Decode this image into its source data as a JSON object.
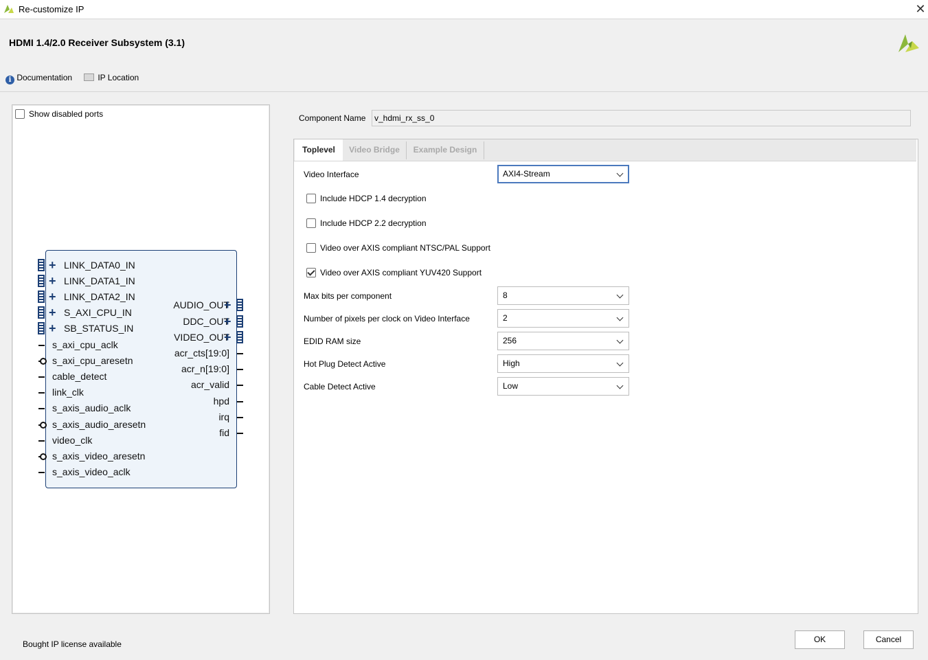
{
  "window": {
    "title": "Re-customize IP",
    "close_glyph": "✕"
  },
  "header": {
    "title": "HDMI 1.4/2.0 Receiver Subsystem (3.1)"
  },
  "toolbar": {
    "documentation": "Documentation",
    "ip_location": "IP Location"
  },
  "symbol": {
    "show_disabled_ports": {
      "label": "Show disabled ports",
      "checked": false
    },
    "left_bus_ports": [
      "LINK_DATA0_IN",
      "LINK_DATA1_IN",
      "LINK_DATA2_IN",
      "S_AXI_CPU_IN",
      "SB_STATUS_IN"
    ],
    "left_ports": [
      "s_axi_cpu_aclk",
      "s_axi_cpu_aresetn",
      "cable_detect",
      "link_clk",
      "s_axis_audio_aclk",
      "s_axis_audio_aresetn",
      "video_clk",
      "s_axis_video_aresetn",
      "s_axis_video_aclk"
    ],
    "left_port_active_low": [
      false,
      true,
      false,
      false,
      false,
      true,
      false,
      true,
      false
    ],
    "right_bus_ports": [
      "AUDIO_OUT",
      "DDC_OUT",
      "VIDEO_OUT"
    ],
    "right_ports": [
      "acr_cts[19:0]",
      "acr_n[19:0]",
      "acr_valid",
      "hpd",
      "irq",
      "fid"
    ]
  },
  "component": {
    "label": "Component Name",
    "value": "v_hdmi_rx_ss_0"
  },
  "tabs": [
    "Toplevel",
    "Video Bridge",
    "Example Design"
  ],
  "active_tab": "Toplevel",
  "toplevel": {
    "video_interface": {
      "label": "Video Interface",
      "value": "AXI4-Stream"
    },
    "checkboxes": [
      {
        "label": "Include HDCP 1.4 decryption",
        "checked": false
      },
      {
        "label": "Include HDCP 2.2 decryption",
        "checked": false
      },
      {
        "label": "Video over AXIS compliant NTSC/PAL Support",
        "checked": false
      },
      {
        "label": "Video over AXIS compliant YUV420 Support",
        "checked": true
      }
    ],
    "fields": [
      {
        "label": "Max bits per component",
        "value": "8"
      },
      {
        "label": "Number of pixels per clock on Video Interface",
        "value": "2"
      },
      {
        "label": "EDID RAM size",
        "value": "256"
      },
      {
        "label": "Hot Plug Detect Active",
        "value": "High"
      },
      {
        "label": "Cable Detect Active",
        "value": "Low"
      }
    ]
  },
  "footer": {
    "license": "Bought IP license available",
    "ok": "OK",
    "cancel": "Cancel"
  },
  "colors": {
    "block_border": "#1c3f75",
    "block_fill": "#eef4fa",
    "focus": "#4b79bd",
    "brand_green": "#8cb83c"
  },
  "icons": [
    "xilinx-logo-icon",
    "info-icon",
    "folder-icon",
    "close-icon",
    "chevron-down-icon",
    "plus-icon"
  ]
}
